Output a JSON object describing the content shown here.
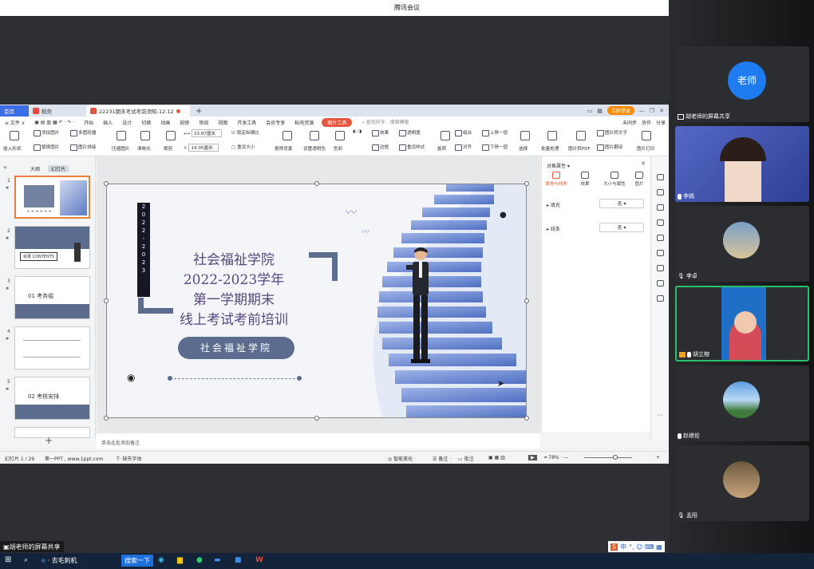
{
  "window_title": "腾讯会议",
  "wps": {
    "tabs": {
      "home": "首页",
      "wps": "稻壳",
      "doc": "22231期末考试考前须知-12.12"
    },
    "login": "立即登录",
    "menus": [
      "≡ 文件 ∨",
      "开始",
      "插入",
      "设计",
      "切换",
      "动画",
      "放映",
      "审阅",
      "视图",
      "开发工具",
      "会员专享",
      "稻壳资源"
    ],
    "active_menu": "图片工具",
    "search_placeholder": "查找命令、搜索模板",
    "menu_right": [
      "未同步",
      "协作",
      "分享"
    ],
    "ribbon": {
      "insert_shape": "插入形状",
      "add_pic": "添加图片",
      "multi_outline": "多图轮播",
      "replace_pic": "替换图片",
      "pic_merge": "图片拼接",
      "compress": "压缩图片",
      "clarify": "清晰化",
      "crop": "裁剪",
      "width": "33.87厘米",
      "height": "19.05厘米",
      "lock_ratio": "锁定纵横比",
      "reset_size": "重设大小",
      "remove_bg": "抠除背景",
      "transparent": "设置透明色",
      "color": "色彩",
      "effects": "效果",
      "transparency": "透明度",
      "border": "边框",
      "reset_style": "重设样式",
      "rotate": "旋转",
      "combine": "组合",
      "align": "对齐",
      "up_layer": "上移一层",
      "down_layer": "下移一层",
      "select": "选择",
      "batch": "批量处理",
      "to_pdf": "图片转PDF",
      "to_text": "图片转文字",
      "translate": "图片翻译",
      "print": "图片打印"
    },
    "left_tabs": [
      "大纲",
      "幻灯片"
    ],
    "thumbnails": [
      {
        "n": "1",
        "text": "",
        "selected": true
      },
      {
        "n": "2",
        "text": "目录 CONTENTS",
        "selected": false
      },
      {
        "n": "3",
        "text": "01  考务组",
        "selected": false
      },
      {
        "n": "4",
        "text": "",
        "selected": false
      },
      {
        "n": "5",
        "text": "02  考核安排",
        "selected": false
      }
    ],
    "slide": {
      "year_vertical": [
        "2",
        "0",
        "2",
        "2",
        "-",
        "2",
        "0",
        "2",
        "3"
      ],
      "title_lines": [
        "社会福祉学院",
        "2022-2023学年",
        "第一学期期末",
        "线上考试考前培训"
      ],
      "pill": "社会福祉学院"
    },
    "right_panel": {
      "header": "对象属性 ▾",
      "tabs": [
        "填充与线条",
        "效果",
        "大小与属性",
        "图片"
      ],
      "fill_label": "填充",
      "fill_value": "无",
      "line_label": "线条",
      "line_value": "无"
    },
    "notes_placeholder": "单击此处添加备注",
    "status": {
      "slide_count": "幻灯片 1 / 29",
      "theme": "第一PPT , www.1ppt.com",
      "missing_font": "缺失字体",
      "beautify": "智能美化",
      "notes": "备注",
      "comments": "批注",
      "zoom": "78%"
    }
  },
  "participants": [
    {
      "name": "胡老师的屏幕共享",
      "avatar_text": "老师",
      "kind": "avatar"
    },
    {
      "name": "李嫣",
      "kind": "video"
    },
    {
      "name": "李卓",
      "kind": "photo"
    },
    {
      "name": "胡立榕",
      "kind": "video"
    },
    {
      "name": "赵继伦",
      "kind": "photo"
    },
    {
      "name": "孟阳",
      "kind": "photo"
    }
  ],
  "share_label": "胡老师的屏幕共享",
  "taskbar": {
    "search_hint": "去毛刺机",
    "search_btn": "搜索一下"
  },
  "ime_label": "中"
}
